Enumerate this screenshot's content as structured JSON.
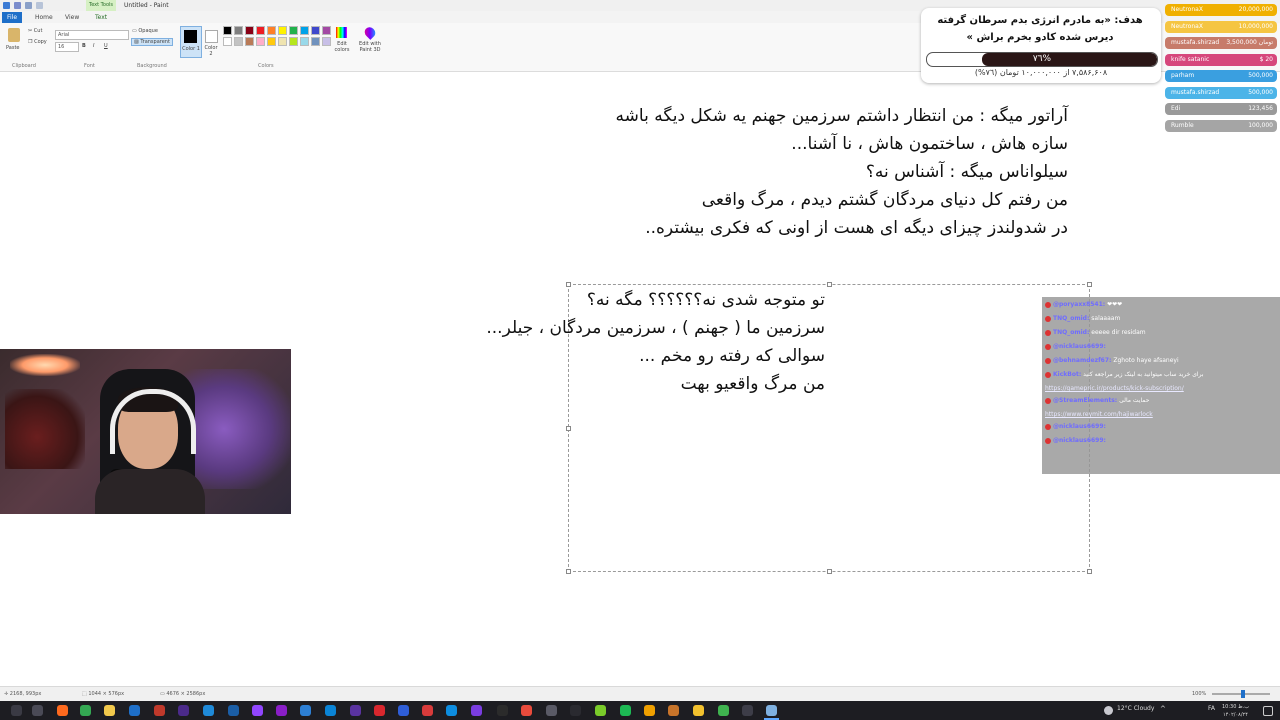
{
  "window": {
    "title": "Untitled - Paint",
    "contextual_tab": "Text Tools"
  },
  "ribbon": {
    "tabs": [
      "File",
      "Home",
      "View",
      "Text"
    ],
    "paste_label": "Paste",
    "cut_label": "Cut",
    "copy_label": "Copy",
    "font_name": "Arial",
    "font_size": "16",
    "bold": "B",
    "italic": "I",
    "underline": "U",
    "opaque_label": "Opaque",
    "transparent_label": "Transparent",
    "color1_label": "Color 1",
    "color2_label": "Color 2",
    "edit_colors_label": "Edit colors",
    "edit_paint3d_label": "Edit with Paint 3D",
    "groups": [
      "Clipboard",
      "Font",
      "Background",
      "Colors"
    ],
    "palette": [
      "#000000",
      "#7f7f7f",
      "#880015",
      "#ed1c24",
      "#ff7f27",
      "#fff200",
      "#22b14c",
      "#00a2e8",
      "#3f48cc",
      "#a349a4",
      "#ffffff",
      "#c3c3c3",
      "#b97a57",
      "#ffaec9",
      "#ffc90e",
      "#efe4b0",
      "#b5e61d",
      "#99d9ea",
      "#7092be",
      "#c8bfe7"
    ]
  },
  "canvas_text": {
    "block1": [
      "آراتور میگه : من انتظار داشتم سرزمین جهنم یه شکل دیگه باشه",
      "سازه هاش ، ساختمون هاش ، نا آشنا...",
      "سیلواناس میگه : آشناس نه؟",
      "من رفتم کل دنیای مردگان گشتم دیدم ، مرگ واقعی",
      "در شدولندز چیزای دیگه ای هست از اونی که فکری بیشتره.."
    ],
    "block2": [
      "تو متوجه شدی نه؟؟؟؟؟؟ مگه نه؟",
      "سرزمین ما ( جهنم ) ، سرزمین مردگان ، جیلر...",
      "سوالی که رفته رو مخم ...",
      "من مرگ واقعیو بهت"
    ]
  },
  "goal": {
    "title": "هدف: «به مادرم انرژی بدم سرطان گرفته دیرس شده کادو بخرم براش »",
    "percent_label": "٧٦%",
    "progress": 0.76,
    "amount": "۷,۵۸۶,۶۰۸ از ۱۰,۰۰۰,۰۰۰ تومان (٧٦%)"
  },
  "donors": [
    {
      "name": "NeutronaX",
      "amount": "20,000,000",
      "color": "#f0b000"
    },
    {
      "name": "NeutronaX",
      "amount": "10,000,000",
      "color": "#f5c542"
    },
    {
      "name": "mustafa.shirzad",
      "amount": "تومان 3,500,000",
      "color": "#c77b6a"
    },
    {
      "name": "knife satanic",
      "amount": "$ 20",
      "color": "#d6477c"
    },
    {
      "name": "parham",
      "amount": "500,000",
      "color": "#3a9fe0"
    },
    {
      "name": "mustafa.shirzad",
      "amount": "500,000",
      "color": "#4cb4e8"
    },
    {
      "name": "Edi",
      "amount": "123,456",
      "color": "#9a9a9a"
    },
    {
      "name": "Rumble",
      "amount": "100,000",
      "color": "#a5a5a5"
    }
  ],
  "chat": [
    {
      "user": "@poryaxx8541:",
      "msg": "❤❤❤",
      "link": ""
    },
    {
      "user": "TNQ_omid:",
      "msg": "salaaaam",
      "link": ""
    },
    {
      "user": "TNQ_omid:",
      "msg": "eeeee dir residam",
      "link": ""
    },
    {
      "user": "@nicklaus6699:",
      "msg": "",
      "link": ""
    },
    {
      "user": "@behnamdezf67:",
      "msg": "Zghoto haye afsaneyi",
      "link": ""
    },
    {
      "user": "KickBot:",
      "msg": "برای خرید ساب میتوانید به لینک زیر مراجعه کنید",
      "link": "https://gamepric.ir/products/kick-subscription/"
    },
    {
      "user": "@StreamElements:",
      "msg": "حمایت مالی",
      "link": "https://www.reymit.com/hajiwarlock"
    },
    {
      "user": "@nicklaus6699:",
      "msg": "",
      "link": ""
    },
    {
      "user": "@nicklaus6699:",
      "msg": "",
      "link": ""
    }
  ],
  "status": {
    "cursor": "2168, 993px",
    "selection": "1044 × 576px",
    "canvas_size": "4676 × 2586px",
    "zoom": "100%"
  },
  "taskbar": {
    "weather": "12°C  Cloudy",
    "lang": "FA",
    "time": "10:30 ب.ظ",
    "date": "۱۴۰۲/۰۸/۲۴"
  }
}
